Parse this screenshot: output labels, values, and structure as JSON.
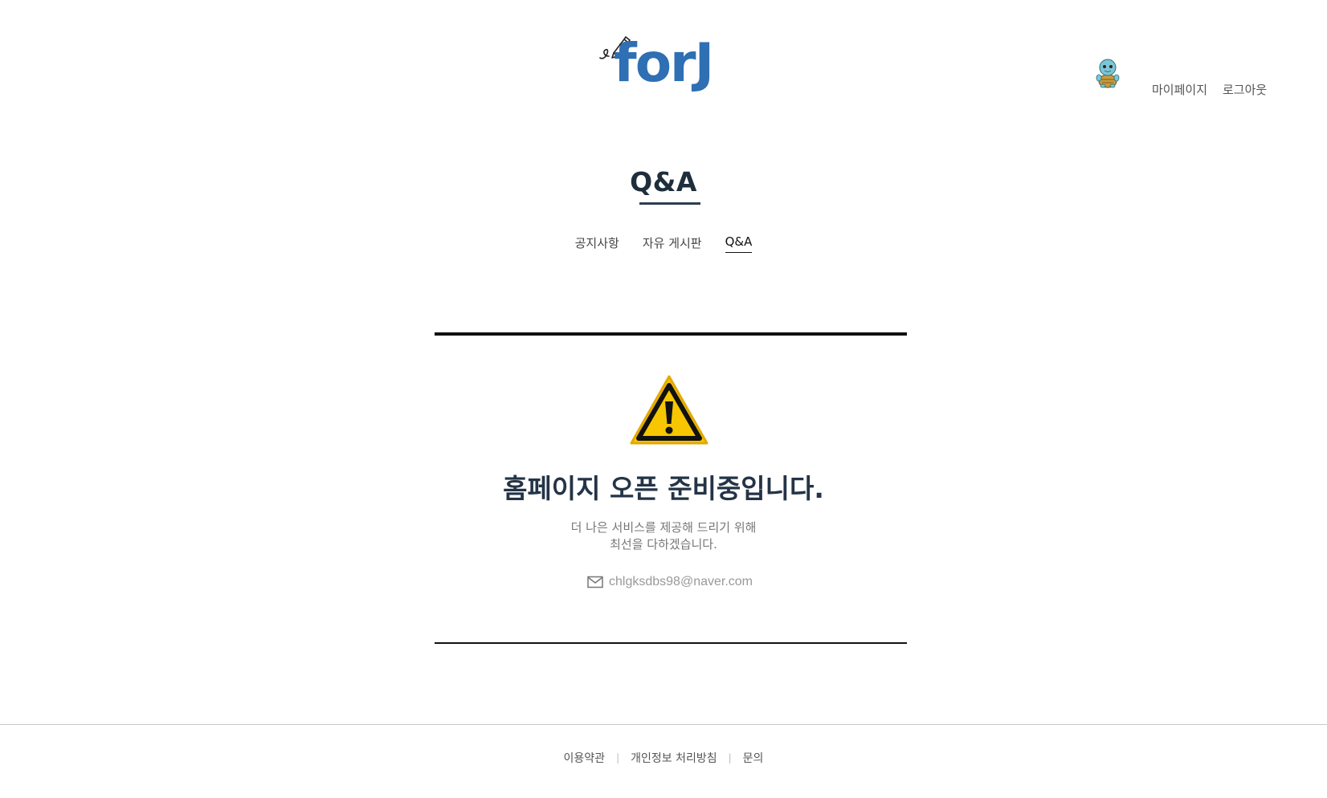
{
  "header": {
    "logo_text": "forJ",
    "nav": {
      "mypage": "마이페이지",
      "logout": "로그아웃"
    }
  },
  "main": {
    "title": "Q&A",
    "tabs": [
      {
        "label": "공지사항",
        "active": false
      },
      {
        "label": "자유 게시판",
        "active": false
      },
      {
        "label": "Q&A",
        "active": true
      }
    ],
    "notice": {
      "heading": "홈페이지 오픈 준비중입니다.",
      "desc_line1": "더 나은 서비스를 제공해 드리기 위해",
      "desc_line2": "최선을 다하겠습니다.",
      "email": "chlgksdbs98@naver.com"
    }
  },
  "footer": {
    "links": [
      "이용약관",
      "개인정보 처리방침",
      "문의"
    ],
    "separator": "|"
  },
  "colors": {
    "brand": "#2f6fb3",
    "title": "#1f2e3d",
    "warning_yellow": "#f7c600"
  },
  "icons": {
    "logo": "pencil-icon",
    "avatar": "turtle-avatar-icon",
    "warning": "warning-triangle-icon",
    "email": "mail-icon"
  }
}
